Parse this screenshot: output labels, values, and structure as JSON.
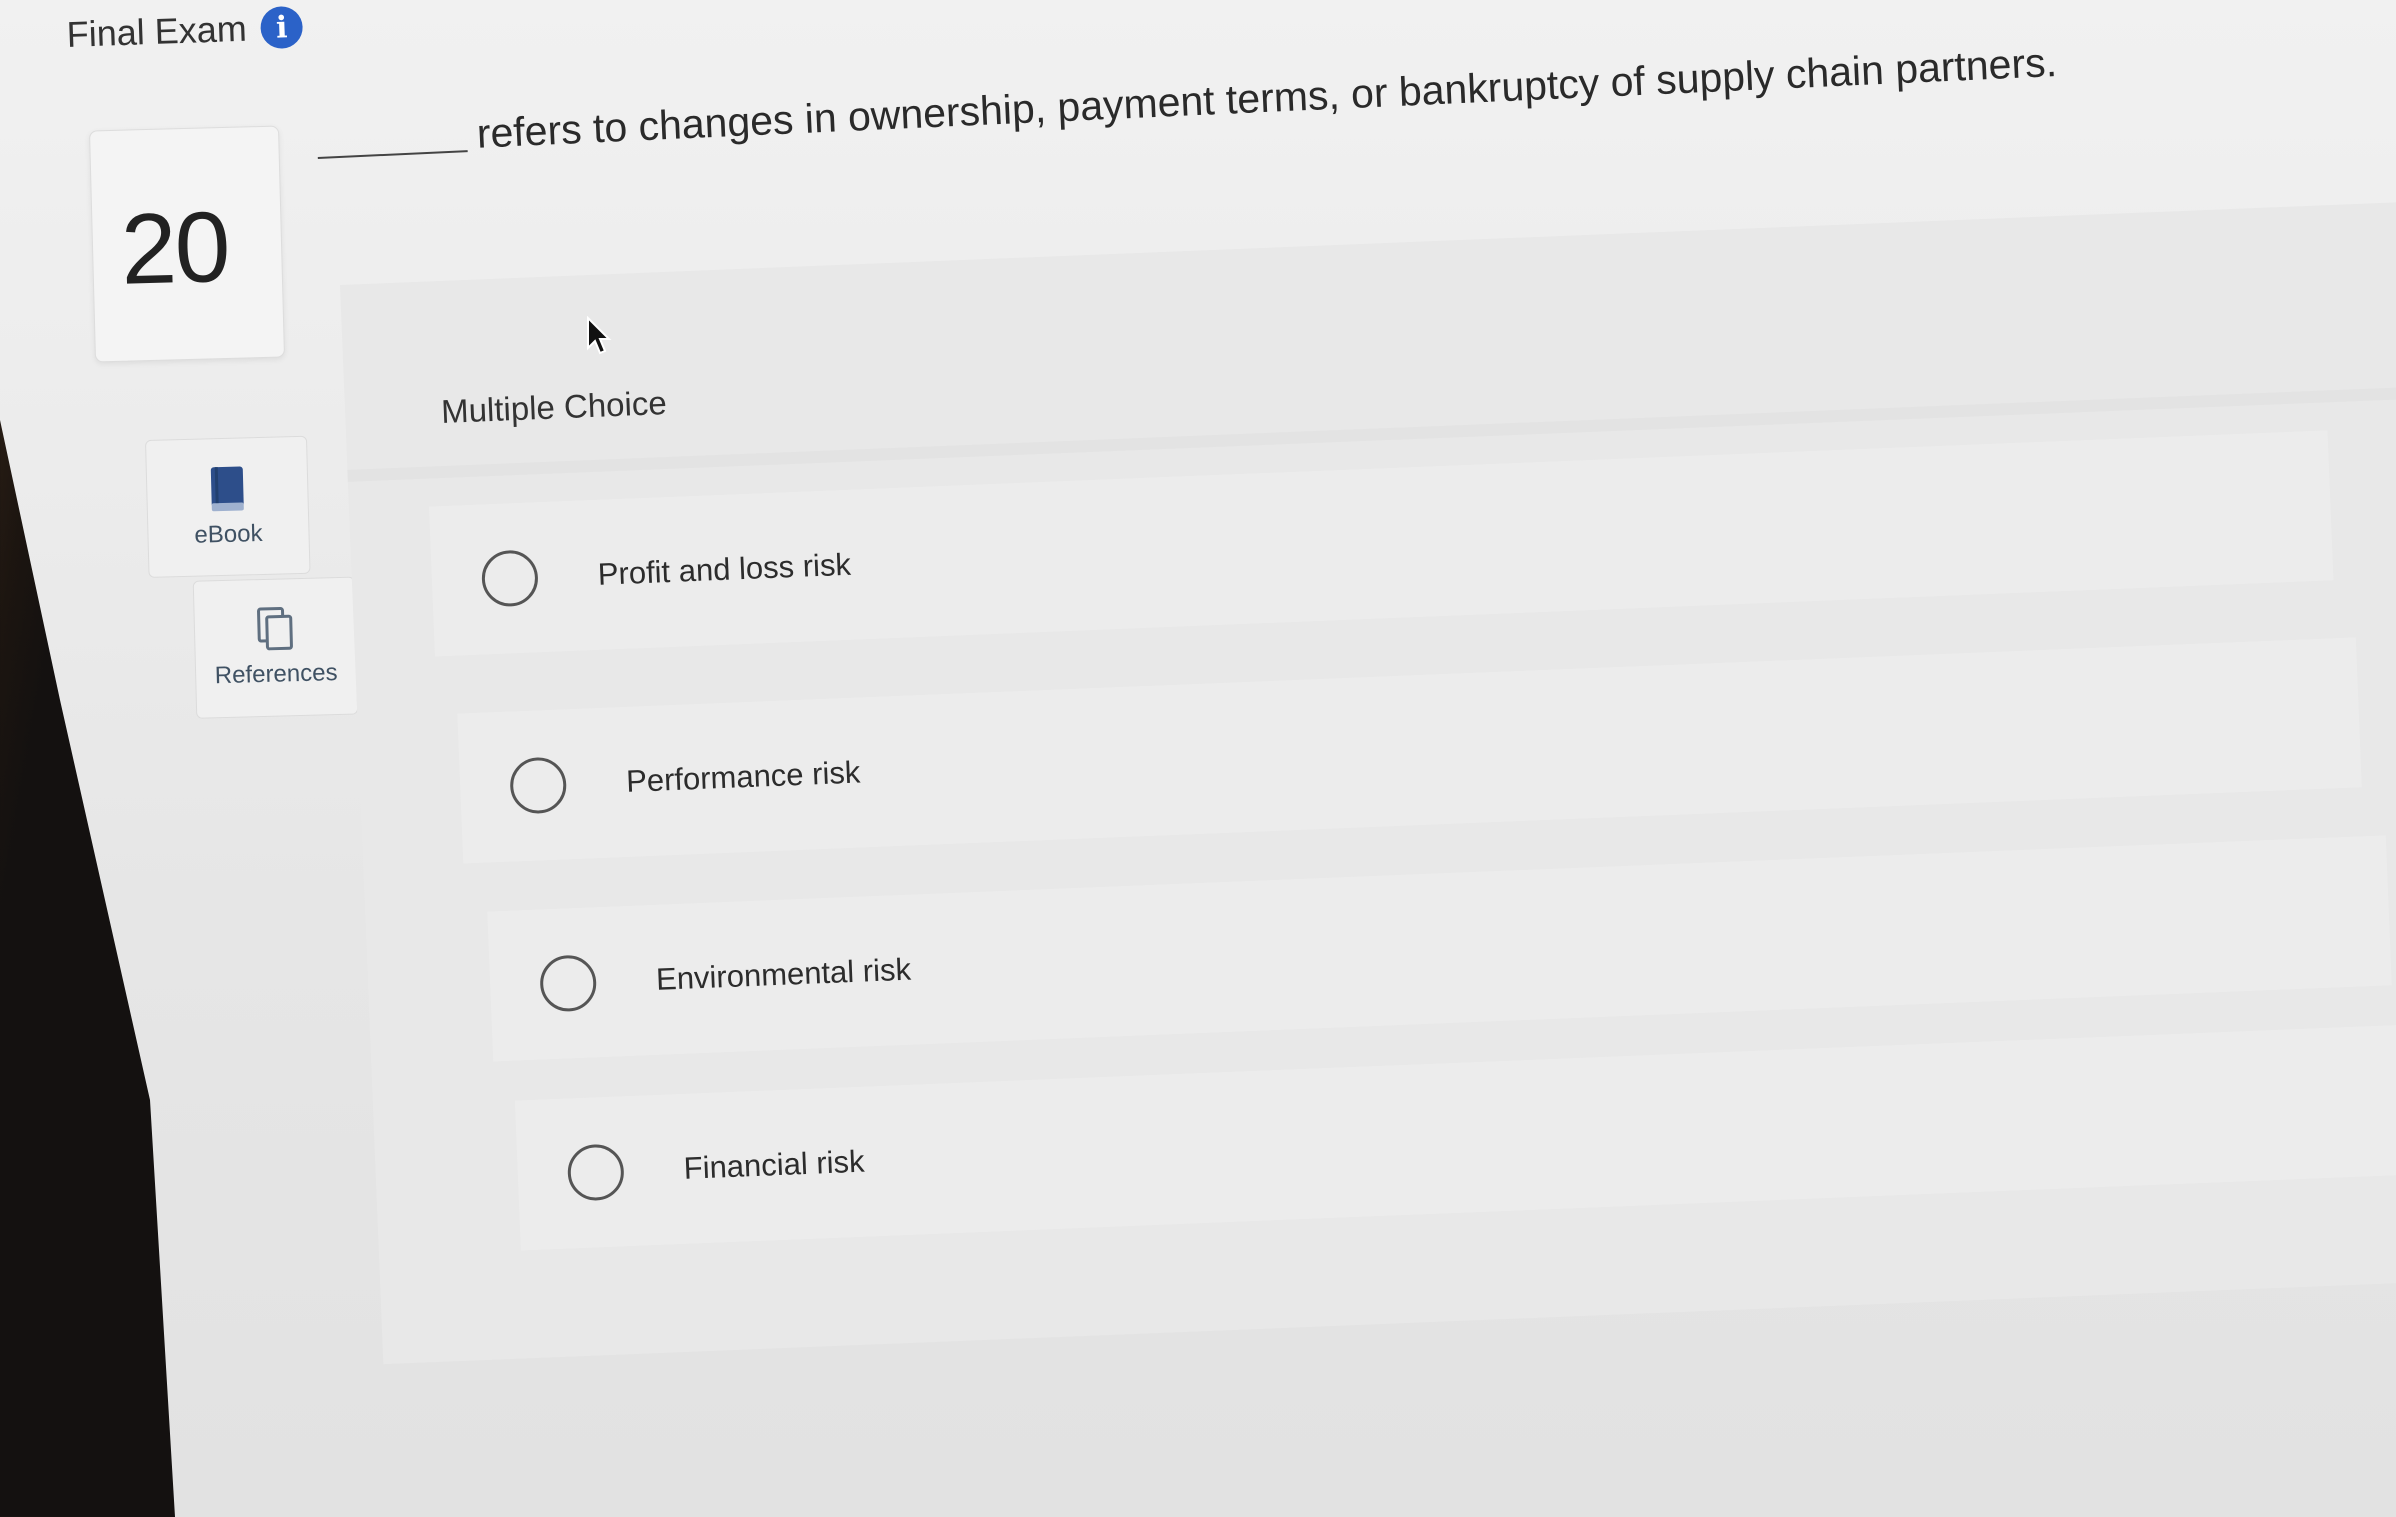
{
  "header": {
    "title": "Final Exam",
    "info_icon": "info-icon"
  },
  "question": {
    "number": "20",
    "text": "refers to changes in ownership, payment terms, or bankruptcy of supply chain partners."
  },
  "answer_panel": {
    "type_label": "Multiple Choice",
    "options": [
      {
        "label": "Profit and loss risk",
        "selected": false
      },
      {
        "label": "Performance risk",
        "selected": false
      },
      {
        "label": "Environmental risk",
        "selected": false
      },
      {
        "label": "Financial risk",
        "selected": false
      }
    ]
  },
  "tools": {
    "ebook": {
      "label": "eBook",
      "icon": "book-icon"
    },
    "references": {
      "label": "References",
      "icon": "references-icon"
    }
  },
  "colors": {
    "info_icon": "#2b62c8",
    "book_icon": "#2d4e8a",
    "tool_label": "#3f5163"
  }
}
